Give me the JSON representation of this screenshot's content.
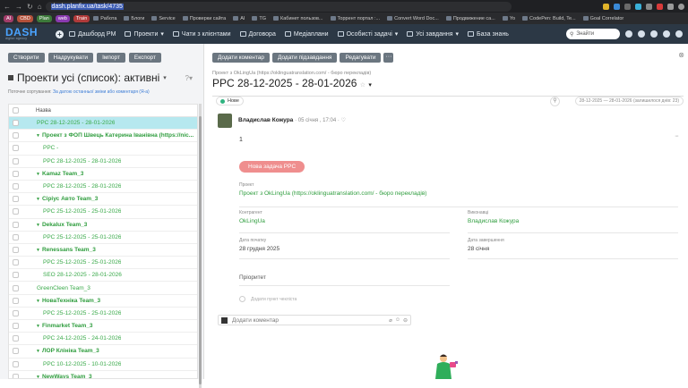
{
  "browser": {
    "url_prefix": "dash.planfix.ua/task/",
    "url_id": "4735"
  },
  "bookmarks": {
    "tags": [
      {
        "label": "AI",
        "color": "#a33d6a"
      },
      {
        "label": "CBD",
        "color": "#b5513a"
      },
      {
        "label": "Plan",
        "color": "#3c7a3a"
      },
      {
        "label": "web",
        "color": "#8a3ab0"
      },
      {
        "label": "Train",
        "color": "#b03a3a"
      }
    ],
    "items": [
      "Работа",
      "Блоги",
      "Service",
      "Проверки сайта",
      "AI",
      "TG",
      "Кабинет пользов...",
      "Торрент портал :...",
      "Convert Word Doc...",
      "Продвижение са...",
      "Yo",
      "CodePen: Build, Te...",
      "Goal Correlator"
    ]
  },
  "appnav": {
    "logo": "DASH",
    "logo_sub": "digital agency",
    "items": [
      "Дашборд PM",
      "Проекти",
      "Чати з клієнтами",
      "Договора",
      "Медіаплани",
      "Особисті задачі",
      "Усі завдання",
      "База знань"
    ],
    "search_placeholder": "Знайти"
  },
  "left": {
    "buttons": [
      "Створити",
      "Надрукувати",
      "Імпорт",
      "Експорт"
    ],
    "title": "Проекти усі (список): активні",
    "sort_label": "Поточне сортування:",
    "sort_value": "За датою останньої зміни або коментаря (Я-а)",
    "column_header": "Назва",
    "rows": [
      {
        "text": "PPC 28-12-2025 - 28-01-2026",
        "kind": "task",
        "indent": 0,
        "active": true
      },
      {
        "text": "Проект з ФОП Швець Катерина Іванівна (https://nic...",
        "kind": "grp",
        "indent": 0
      },
      {
        "text": "PPC -",
        "kind": "task",
        "indent": 1
      },
      {
        "text": "PPC 28-12-2025 - 28-01-2026",
        "kind": "task",
        "indent": 1
      },
      {
        "text": "Kamaz Team_3",
        "kind": "grp",
        "indent": 0
      },
      {
        "text": "PPC 28-12-2025 - 28-01-2026",
        "kind": "task",
        "indent": 1
      },
      {
        "text": "Сіріус Авто Team_3",
        "kind": "grp",
        "indent": 0
      },
      {
        "text": "PPC 25-12-2025 - 25-01-2026",
        "kind": "task",
        "indent": 1
      },
      {
        "text": "Dekalux Team_3",
        "kind": "grp",
        "indent": 0
      },
      {
        "text": "PPC 25-12-2025 - 25-01-2026",
        "kind": "task",
        "indent": 1
      },
      {
        "text": "Renessans Team_3",
        "kind": "grp",
        "indent": 0
      },
      {
        "text": "PPC 25-12-2025 - 25-01-2026",
        "kind": "task",
        "indent": 1
      },
      {
        "text": "SEO 28-12-2025 - 28-01-2026",
        "kind": "task",
        "indent": 1
      },
      {
        "text": "GreenCleen Team_3",
        "kind": "task",
        "indent": 0
      },
      {
        "text": "НоваТехніка Team_3",
        "kind": "grp",
        "indent": 0
      },
      {
        "text": "PPC 25-12-2025 - 25-01-2026",
        "kind": "task",
        "indent": 1
      },
      {
        "text": "Finmarket Team_3",
        "kind": "grp",
        "indent": 0
      },
      {
        "text": "PPC 24-12-2025 - 24-01-2026",
        "kind": "task",
        "indent": 1
      },
      {
        "text": "ЛОР Клініка Team_3",
        "kind": "grp",
        "indent": 0
      },
      {
        "text": "PPC 10-12-2025 - 10-01-2026",
        "kind": "task",
        "indent": 1
      },
      {
        "text": "NewWays Team_3",
        "kind": "grp",
        "indent": 0
      }
    ]
  },
  "right": {
    "buttons": [
      "Додати коментар",
      "Додати підзавдання",
      "Редагувати"
    ],
    "more": "···",
    "crumb": "Проект з OkLingUa (https://oklinguatranslation.com/ - бюро перекладів)",
    "title": "PPC 28-12-2025 - 28-01-2026",
    "status": "Нове",
    "daterange": "28-12-2025 — 28-01-2026  (залишилося днів: 23)",
    "author": "Владислав Кожура",
    "meta": "· 05 січня , 17:04 ·",
    "comment_text": "1",
    "new_task_btn": "Нова задача PPC",
    "fields": {
      "project_label": "Проект",
      "project_value": "Проект з OkLingUa (https://oklinguatranslation.com/ - бюро перекладів)",
      "contractor_label": "Контрагент",
      "contractor_value": "OkLingUa",
      "executor_label": "Виконавці",
      "executor_value": "Владислав Кожура",
      "start_label": "Дата початку",
      "start_value": "28 грудня 2025",
      "end_label": "Дата завершення",
      "end_value": "28 січня"
    },
    "priority": "Пріоритет",
    "checklist_placeholder": "Додати пункт чекліста",
    "add_comment": "Додати коментар"
  }
}
